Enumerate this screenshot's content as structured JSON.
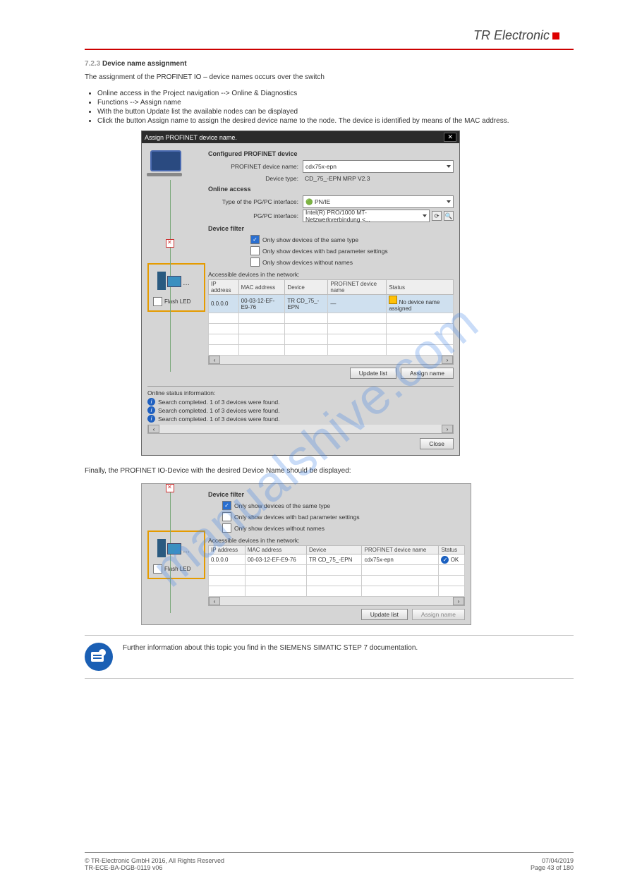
{
  "brand": {
    "name": "TR Electronic"
  },
  "sect": {
    "number": "7.2.3",
    "title": "Device name assignment"
  },
  "para1": "The assignment of the PROFINET IO – device names occurs over the switch",
  "list1": [
    "Online access in the Project navigation --> Online & Diagnostics",
    "Functions --> Assign name",
    "With the button Update list the available nodes can be displayed",
    "Click the button Assign name to assign the desired device name to the node. The device is identified by means of the MAC address."
  ],
  "dialog": {
    "title": "Assign PROFINET device name.",
    "sections": {
      "configured": {
        "heading": "Configured PROFINET device",
        "dev_name_label": "PROFINET device name:",
        "dev_name_val": "cdx75x-epn",
        "dev_type_label": "Device type:",
        "dev_type_val": "CD_75_-EPN MRP V2.3"
      },
      "online": {
        "heading": "Online access",
        "type_if_label": "Type of the PG/PC interface:",
        "type_if_val": "PN/IE",
        "pgpc_label": "PG/PC interface:",
        "pgpc_val": "Intel(R) PRO/1000 MT-Netzwerkverbindung <..."
      },
      "filter": {
        "heading": "Device filter",
        "opt1": "Only show devices of the same type",
        "opt2": "Only show devices with bad parameter settings",
        "opt3": "Only show devices without names"
      }
    },
    "accessible_label": "Accessible devices in the network:",
    "cols": {
      "c1": "IP address",
      "c2": "MAC address",
      "c3": "Device",
      "c4": "PROFINET device name",
      "c5": "Status"
    },
    "row": {
      "ip": "0.0.0.0",
      "mac": "00-03-12-EF-E9-76",
      "dev": "TR CD_75_-EPN",
      "pname": "—",
      "status": "No device name assigned"
    },
    "flash_led": "Flash LED",
    "update_btn": "Update list",
    "assign_btn": "Assign name",
    "status": {
      "heading": "Online status information:",
      "msg": "Search completed. 1 of 3 devices were found.",
      "scroll_info": "<"
    },
    "close_btn": "Close"
  },
  "para2": "Finally, the PROFINET IO-Device with the desired Device Name should be displayed:",
  "detail": {
    "row": {
      "ip": "0.0.0.0",
      "mac": "00-03-12-EF-E9-76",
      "dev": "TR CD_75_-EPN",
      "pname": "cdx75x-epn",
      "status": "OK"
    }
  },
  "note": "Further information about this topic you find in the SIEMENS SIMATIC STEP 7 documentation.",
  "footer": {
    "copyright": "© TR-Electronic GmbH 2016, All Rights Reserved",
    "date": "07/04/2019",
    "doc": "TR-ECE-BA-DGB-0119 v06",
    "page": "Page 43 of 180"
  },
  "watermark": "manualshive.com"
}
